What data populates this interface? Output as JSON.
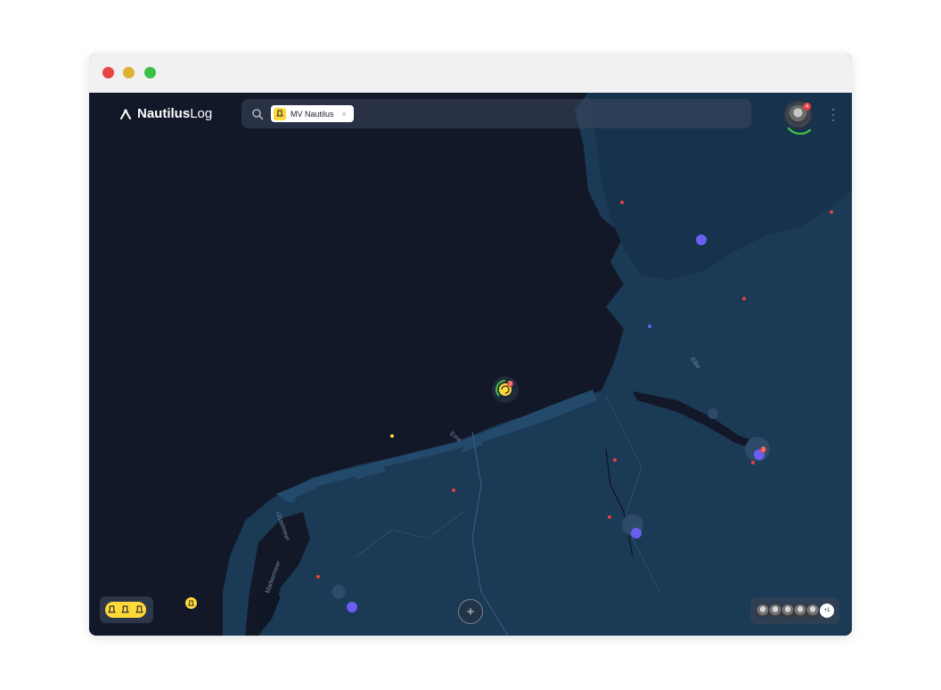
{
  "app": {
    "brand_part1": "Nautilus",
    "brand_part2": "Log",
    "logo_icon": "compass-anchor-icon"
  },
  "search": {
    "icon": "search-icon",
    "placeholder": "",
    "chip_label": "MV Nautilus",
    "chip_icon": "boat-icon",
    "chip_close": "×"
  },
  "user": {
    "avatar_icon": "user-avatar",
    "notification_count": "4",
    "menu_icon": "kebab-menu-icon"
  },
  "map": {
    "labels": {
      "elbe": "Elbe",
      "ijsselmeer": "IJsselmeer",
      "markermeer": "Markermeer",
      "ems": "Ems"
    },
    "selected_vessel_badge": "3",
    "port_badge": "2"
  },
  "controls": {
    "add_label": "+",
    "crew_more_label": "+1",
    "vessel_count_icons": [
      "boat-icon",
      "boat-icon",
      "boat-icon"
    ]
  },
  "colors": {
    "sea": "#121828",
    "land": "#1b3a56",
    "accent_yellow": "#ffd83a",
    "port_purple": "#6a5ef0",
    "poi_red": "#e4413c",
    "progress_green": "#3cbf44"
  }
}
